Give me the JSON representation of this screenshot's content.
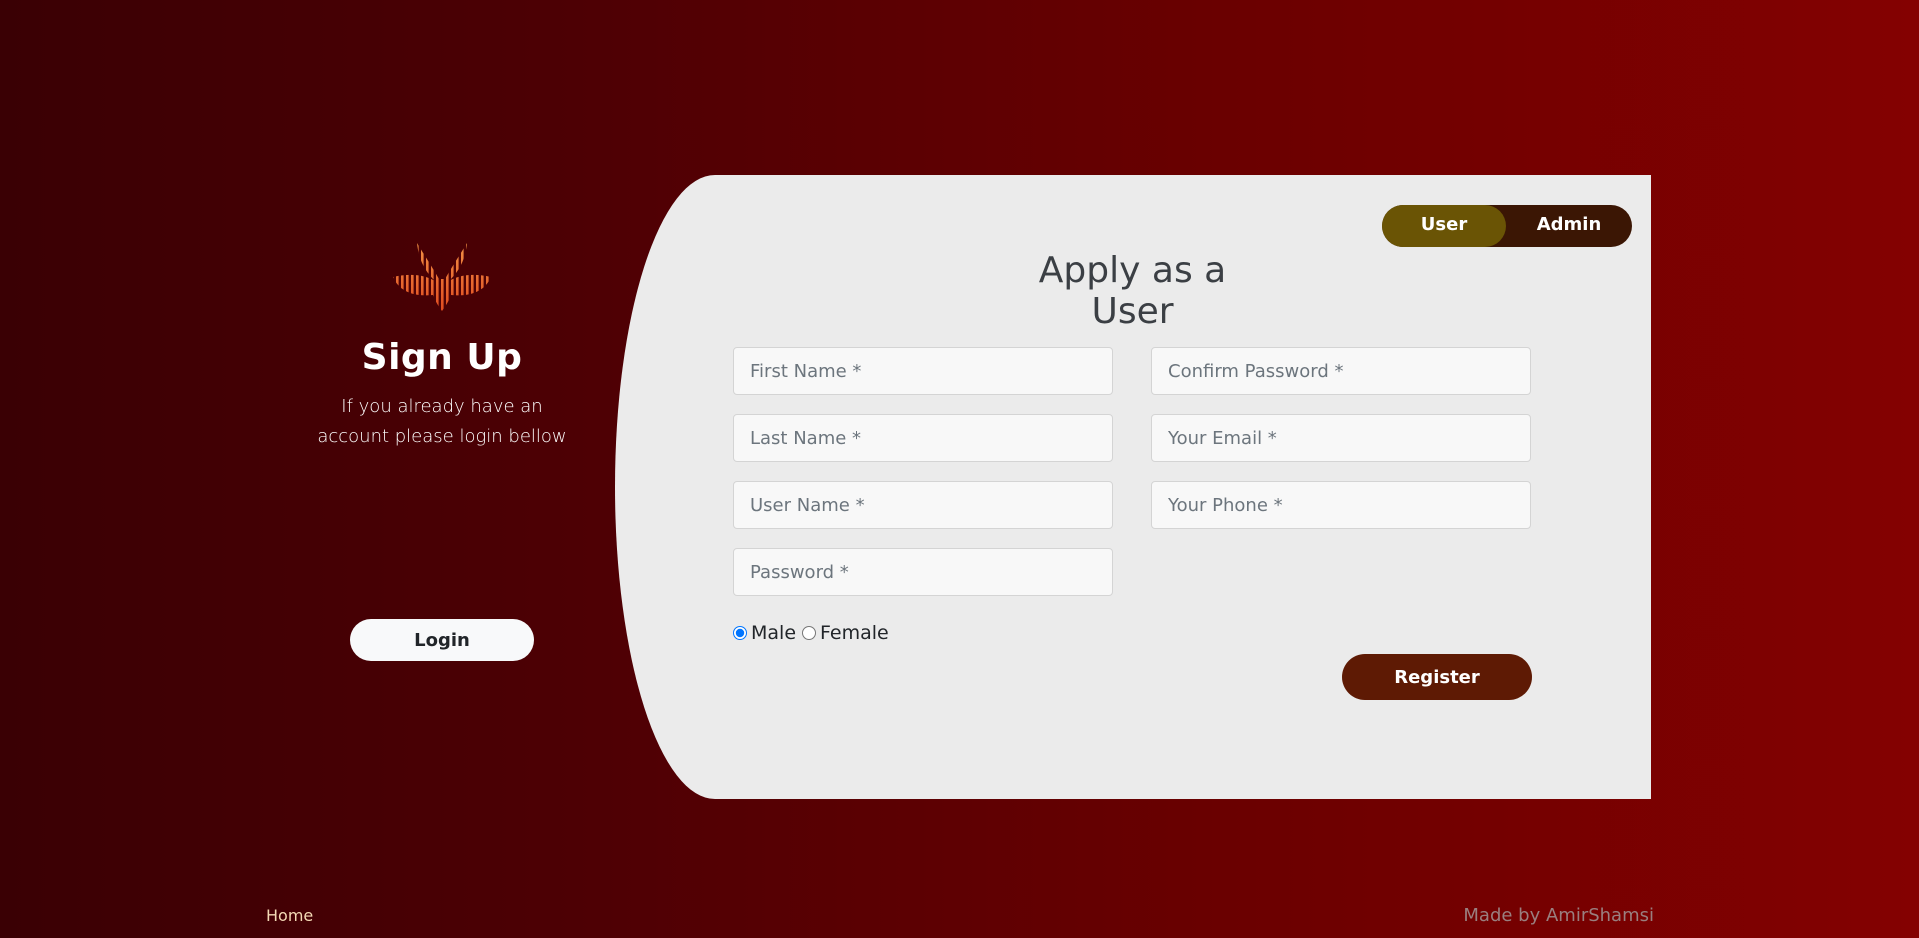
{
  "left": {
    "logo": "lotus-logo-icon",
    "title": "Sign Up",
    "subtitle": "If you already have an account please login bellow",
    "login_label": "Login"
  },
  "toggle": {
    "user_label": "User",
    "admin_label": "Admin",
    "selected": "User"
  },
  "form": {
    "title": "Apply as a User",
    "fields": {
      "first_name": "First Name *",
      "last_name": "Last Name *",
      "user_name": "User Name *",
      "password": "Password *",
      "confirm_password": "Confirm Password *",
      "email": "Your Email *",
      "phone": "Your Phone *"
    },
    "gender": {
      "male_label": "Male",
      "female_label": "Female",
      "selected": "Male"
    },
    "register_label": "Register"
  },
  "footer": {
    "home_label": "Home",
    "credit": "Made by AmirShamsi"
  },
  "colors": {
    "card": "#ebebeb",
    "toggle_active": "#6a5405",
    "toggle_bg": "#3b1604",
    "register": "#5e1a04",
    "logo_orange": "#ef7a2e"
  }
}
